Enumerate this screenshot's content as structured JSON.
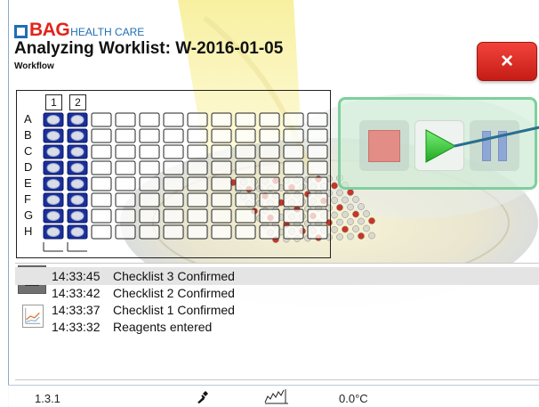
{
  "header": {
    "logo_brand": "BAG",
    "logo_suffix": "HEALTH CARE",
    "title": "Analyzing Worklist: W-2016-01-05",
    "subtitle": "Workflow"
  },
  "close_button": {
    "label": "×"
  },
  "plate": {
    "columns_loaded": [
      "1",
      "2"
    ],
    "rows": [
      "A",
      "B",
      "C",
      "D",
      "E",
      "F",
      "G",
      "H"
    ],
    "column_count": 12,
    "sample_color": "#1a2f9e"
  },
  "controls": {
    "stop": {
      "icon": "stop-icon",
      "enabled": false
    },
    "play": {
      "icon": "play-icon",
      "enabled": true
    },
    "pause": {
      "icon": "pause-icon",
      "enabled": false
    }
  },
  "log": {
    "entries": [
      {
        "time": "14:33:45",
        "message": "Checklist 3 Confirmed",
        "selected": true
      },
      {
        "time": "14:33:42",
        "message": "Checklist 2 Confirmed",
        "selected": false
      },
      {
        "time": "14:33:37",
        "message": "Checklist 1 Confirmed",
        "selected": false
      },
      {
        "time": "14:33:32",
        "message": "Reagents entered",
        "selected": false
      }
    ],
    "side_icons": [
      "list-icon",
      "chart-icon"
    ]
  },
  "status": {
    "version": "1.3.1",
    "tool_icon": "pipette-icon",
    "graph_icon": "temperature-graph-icon",
    "temperature": "0.0°C"
  },
  "colors": {
    "brand_red": "#e2231a",
    "brand_blue": "#1f6eb5",
    "close_red": "#d9251d",
    "control_border": "#7fcf9d",
    "play_green": "#33cc33"
  }
}
